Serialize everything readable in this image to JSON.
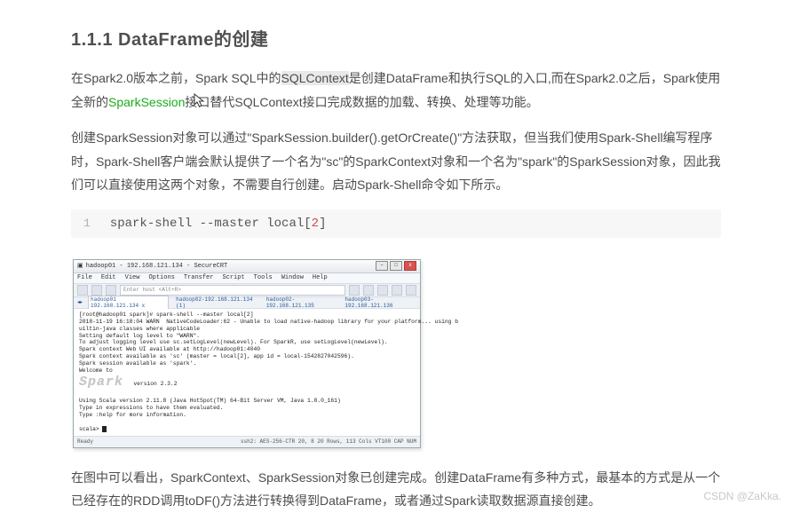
{
  "heading": "1.1.1 DataFrame的创建",
  "para1": {
    "a": "在Spark2.0版本之前，Spark SQL中的",
    "hl": "SQLContext",
    "b": "是创建DataFrame和执行SQL的入口,而在Spark2.0之后，Spark使用全新的",
    "green": "SparkSession",
    "c": "接口替代SQLContext接口完成数据的加载、转换、处理等功能。"
  },
  "para2": "创建SparkSession对象可以通过\"SparkSession.builder().getOrCreate()\"方法获取，但当我们使用Spark-Shell编写程序时，Spark-Shell客户端会默认提供了一个名为\"sc\"的SparkContext对象和一个名为\"spark\"的SparkSession对象，因此我们可以直接使用这两个对象，不需要自行创建。启动Spark-Shell命令如下所示。",
  "code": {
    "ln": "1",
    "pre": "spark-shell --master local[",
    "num": "2",
    "post": "]"
  },
  "term": {
    "title": "hadoop01 - 192.168.121.134 - SecureCRT",
    "menu": [
      "File",
      "Edit",
      "View",
      "Options",
      "Transfer",
      "Script",
      "Tools",
      "Window",
      "Help"
    ],
    "toolbar_hint": "Enter host <Alt+R>",
    "tabs": [
      "hadoop01 192.168.121.134  x",
      "hadoop02-192.168.121.134 (1)",
      "hadoop02-192.168.121.135",
      "hadoop03-192.168.121.136"
    ],
    "lines": [
      "[root@hadoop01 spark]# spark-shell --master local[2]",
      "2018-11-19 16:18:04 WARN  NativeCodeLoader:62 - Unable to load native-hadoop library for your platform... using b",
      "uiltin-java classes where applicable",
      "Setting default log level to \"WARN\".",
      "To adjust logging level use sc.setLogLevel(newLevel). For SparkR, use setLogLevel(newLevel).",
      "Spark context Web UI available at http://hadoop01:4040",
      "Spark context available as 'sc' (master = local[2], app id = local-1542827042596).",
      "Spark session available as 'spark'.",
      "Welcome to"
    ],
    "logo": "Spark",
    "version": "   version 2.3.2",
    "lines2": [
      "",
      "Using Scala version 2.11.8 (Java HotSpot(TM) 64-Bit Server VM, Java 1.8.0_161)",
      "Type in expressions to have them evaluated.",
      "Type :help for more information.",
      "",
      "scala> "
    ],
    "status_left": "Ready",
    "status_right": "ssh2: AES-256-CTR    20,  8  20 Rows, 113 Cols  VT100            CAP NUM"
  },
  "para3": "在图中可以看出，SparkContext、SparkSession对象已创建完成。创建DataFrame有多种方式，最基本的方式是从一个已经存在的RDD调用toDF()方法进行转换得到DataFrame，或者通过Spark读取数据源直接创建。",
  "watermark": "CSDN @ZaKka."
}
